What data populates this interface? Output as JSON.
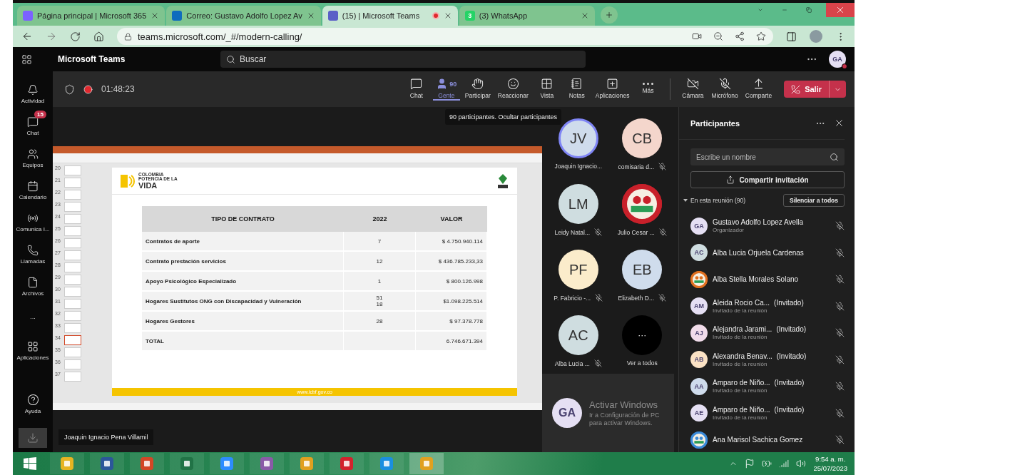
{
  "browser": {
    "tabs": [
      {
        "title": "Página principal | Microsoft 365",
        "selected": false,
        "recording": false
      },
      {
        "title": "Correo: Gustavo Adolfo Lopez Av",
        "selected": false,
        "recording": false
      },
      {
        "title": "(15) | Microsoft Teams",
        "selected": true,
        "recording": true
      },
      {
        "title": "(3) WhatsApp",
        "selected": false,
        "recording": false,
        "badge": "3"
      }
    ],
    "url": "teams.microsoft.com/_#/modern-calling/"
  },
  "teams": {
    "app_name": "Microsoft Teams",
    "search": {
      "placeholder": "Buscar"
    },
    "user_initials": "GA"
  },
  "rail": {
    "items": [
      {
        "label": "Actividad"
      },
      {
        "label": "Chat",
        "badge": "15"
      },
      {
        "label": "Equipos"
      },
      {
        "label": "Calendario"
      },
      {
        "label": "Comunica I..."
      },
      {
        "label": "Llamadas"
      },
      {
        "label": "Archivos"
      },
      {
        "label": "···"
      },
      {
        "label": "Aplicaciones"
      }
    ],
    "help": "Ayuda"
  },
  "meeting": {
    "timer": "01:48:23",
    "toolbar": [
      {
        "label": "Chat",
        "selected": false
      },
      {
        "label": "Gente",
        "count": "90",
        "selected": true
      },
      {
        "label": "Participar",
        "selected": false
      },
      {
        "label": "Reaccionar",
        "selected": false
      },
      {
        "label": "Vista",
        "selected": false
      },
      {
        "label": "Notas",
        "selected": false
      },
      {
        "label": "Aplicaciones",
        "selected": false
      },
      {
        "label": "Más",
        "selected": false
      }
    ],
    "devices": [
      {
        "label": "Cámara"
      },
      {
        "label": "Micrófono"
      },
      {
        "label": "Comparte"
      }
    ],
    "leave": "Salir",
    "tooltip": "90 participantes. Ocultar participantes",
    "presenter": "Joaquin Ignacio Pena Villamil"
  },
  "slide": {
    "thumbnails": [
      {
        "number": "20",
        "selected": false
      },
      {
        "number": "21",
        "selected": false
      },
      {
        "number": "22",
        "selected": false
      },
      {
        "number": "23",
        "selected": false
      },
      {
        "number": "24",
        "selected": false
      },
      {
        "number": "25",
        "selected": false
      },
      {
        "number": "26",
        "selected": false
      },
      {
        "number": "27",
        "selected": false
      },
      {
        "number": "28",
        "selected": false
      },
      {
        "number": "29",
        "selected": false
      },
      {
        "number": "30",
        "selected": false
      },
      {
        "number": "31",
        "selected": false
      },
      {
        "number": "32",
        "selected": false
      },
      {
        "number": "33",
        "selected": false
      },
      {
        "number": "34",
        "selected": true
      },
      {
        "number": "35",
        "selected": false
      },
      {
        "number": "36",
        "selected": false
      },
      {
        "number": "37",
        "selected": false
      }
    ],
    "logo": {
      "line_1": "COLOMBIA",
      "line_2": "POTENCIA DE LA",
      "line_3": "VIDA"
    },
    "table": {
      "columns": [
        "TIPO DE CONTRATO",
        "2022",
        "VALOR"
      ],
      "rows": [
        [
          "Contratos de aporte",
          "7",
          "$ 4.750.940.114"
        ],
        [
          "Contrato prestación servicios",
          "12",
          "$ 436.785.233,33"
        ],
        [
          "Apoyo Psicológico Especializado",
          "1",
          "$ 800.126.998"
        ],
        [
          "Hogares Sustitutos ONG con Discapacidad y Vulneración",
          "51\n18",
          "$1.098.225.514"
        ],
        [
          "Hogares Gestores",
          "28",
          "$ 97.378.778"
        ],
        [
          "TOTAL",
          null,
          "6.746.671.394"
        ]
      ]
    },
    "footer": "www.icbf.gov.co"
  },
  "gallery": {
    "tiles": [
      {
        "initials": "JV",
        "name": "Joaquin Ignacio...",
        "muted": false,
        "speaking": true,
        "kind": "initials",
        "color": "#cfdcec"
      },
      {
        "initials": "CB",
        "name": "comisaria d...",
        "muted": true,
        "speaking": false,
        "kind": "initials",
        "color": "#f4d6cc"
      },
      {
        "initials": "LM",
        "name": "Leidy Natal...",
        "muted": true,
        "speaking": false,
        "kind": "initials",
        "color": "#cfdde0"
      },
      {
        "name": "Julio Cesar ...",
        "muted": true,
        "speaking": false,
        "kind": "picture",
        "color": "#c8202a"
      },
      {
        "initials": "PF",
        "name": "P. Fabricio -...",
        "muted": true,
        "speaking": false,
        "kind": "initials",
        "color": "#fbeccb"
      },
      {
        "initials": "EB",
        "name": "Elizabeth D...",
        "muted": true,
        "speaking": false,
        "kind": "initials",
        "color": "#cfdcec"
      },
      {
        "initials": "AC",
        "name": "Alba Lucia ...",
        "muted": true,
        "speaking": false,
        "kind": "initials",
        "color": "#cfdde0"
      }
    ],
    "see_all": {
      "symbol": "···",
      "label": "Ver a todos"
    },
    "self_initials": "GA"
  },
  "panel": {
    "title": "Participantes",
    "search": {
      "placeholder": "Escribe un nombre"
    },
    "share": "Compartir invitación",
    "section": {
      "label": "En esta reunión (90)",
      "expanded": true
    },
    "mute_all": "Silenciar a todos",
    "participants": [
      {
        "initials": "GA",
        "name": "Gustavo Adolfo Lopez Avella",
        "role": "Organizador",
        "kind": "initials",
        "color": "#e5dff3"
      },
      {
        "initials": "AC",
        "name": "Alba Lucia Orjuela Cardenas",
        "kind": "initials",
        "color": "#cfdde0"
      },
      {
        "name": "Alba Stella Morales Solano",
        "kind": "picture",
        "color": "#e07020"
      },
      {
        "initials": "AM",
        "name": "Aleida Rocio Ca...",
        "tag": "(Invitado)",
        "role": "Invitado de la reunión",
        "kind": "initials",
        "color": "#e5dff3"
      },
      {
        "initials": "AJ",
        "name": "Alejandra Jarami...",
        "tag": "(Invitado)",
        "role": "Invitado de la reunión",
        "kind": "initials",
        "color": "#f1dcea"
      },
      {
        "initials": "AB",
        "name": "Alexandra Benav...",
        "tag": "(Invitado)",
        "role": "Invitado de la reunión",
        "kind": "initials",
        "color": "#fbe2c4"
      },
      {
        "initials": "AA",
        "name": "Amparo de Niño...",
        "tag": "(Invitado)",
        "role": "Invitado de la reunión",
        "kind": "initials",
        "color": "#cfdcec"
      },
      {
        "initials": "AE",
        "name": "Amparo de Niño...",
        "tag": "(Invitado)",
        "role": "Invitado de la reunión",
        "kind": "initials",
        "color": "#e5dff3"
      },
      {
        "name": "Ana Marisol Sachica Gomez",
        "kind": "picture",
        "color": "#3a8ad8"
      }
    ]
  },
  "os_notice": {
    "title": "Activar Windows",
    "text": "Ir a Configuración de PC para activar Windows."
  },
  "taskbar": {
    "time": "9:54 a. m.",
    "date": "25/07/2023"
  }
}
